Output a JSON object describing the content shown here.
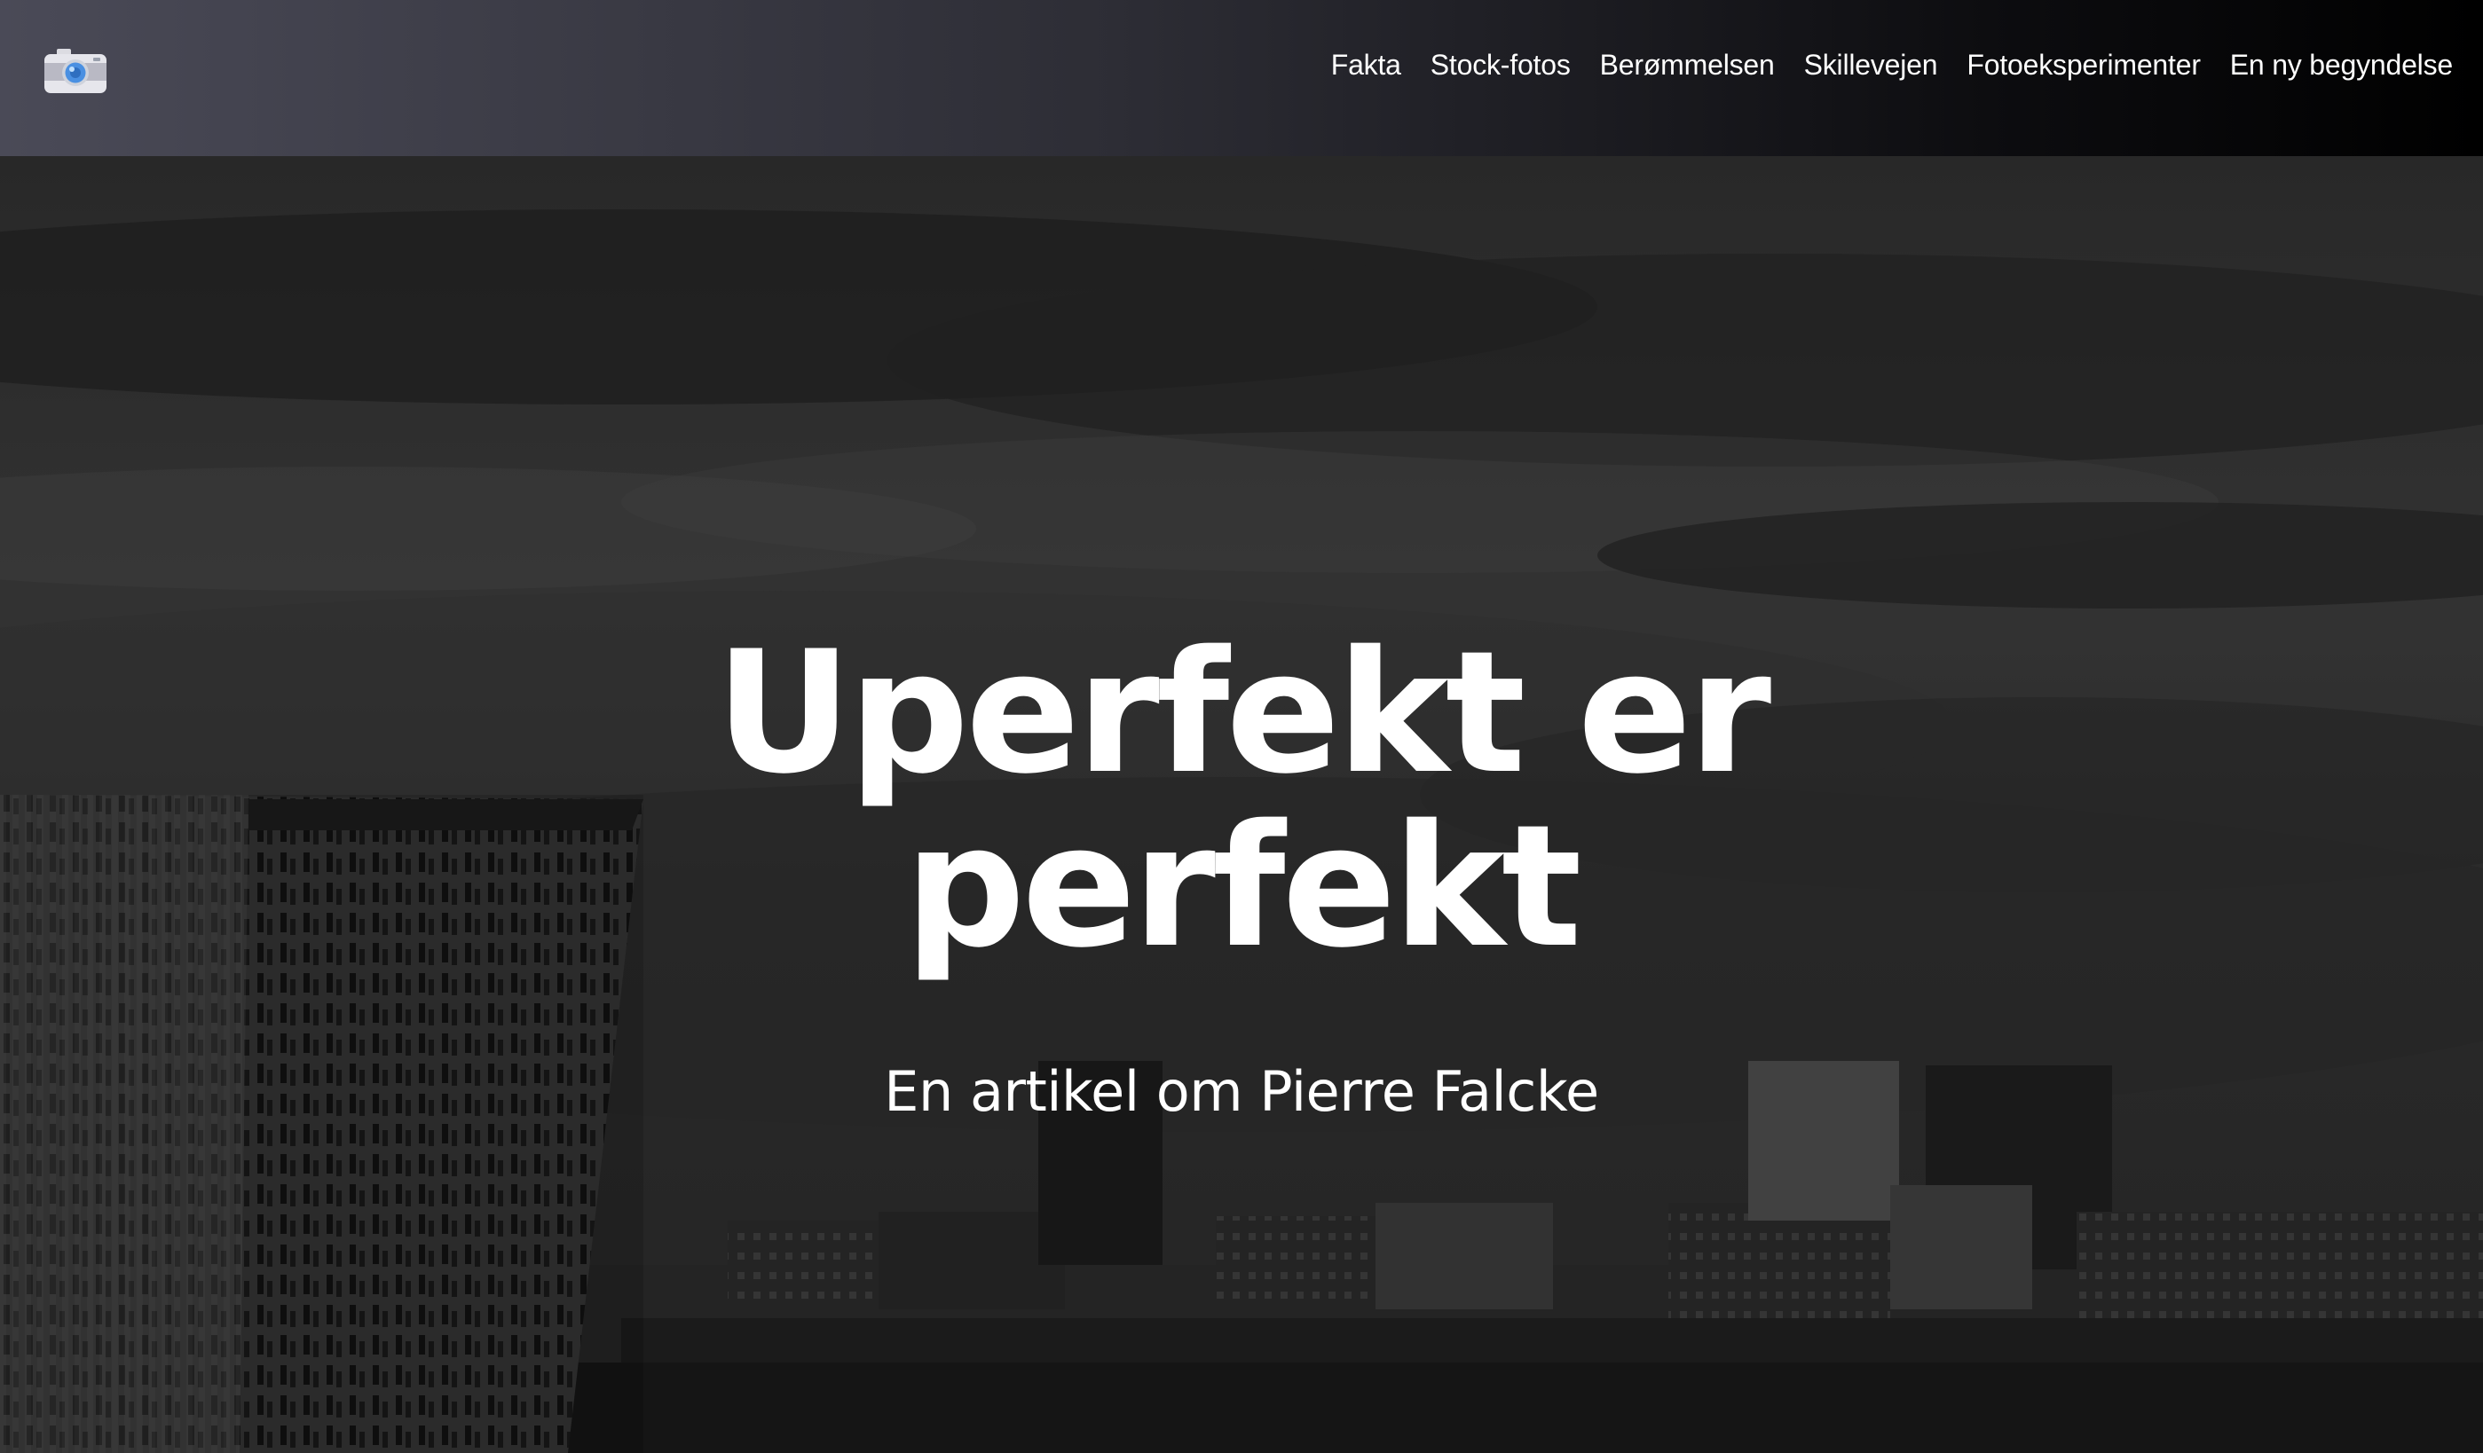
{
  "header": {
    "logo_icon": "camera-icon",
    "nav": [
      {
        "label": "Fakta"
      },
      {
        "label": "Stock-fotos"
      },
      {
        "label": "Berømmelsen"
      },
      {
        "label": "Skillevejen"
      },
      {
        "label": "Fotoeksperimenter"
      },
      {
        "label": "En ny begyndelse"
      }
    ]
  },
  "hero": {
    "title_line1": "Uperfekt er",
    "title_line2": "perfekt",
    "subtitle": "En artikel om Pierre Falcke",
    "background": "grayscale-city-skyline-photo"
  },
  "colors": {
    "nav_gradient_start": "#4a4a57",
    "nav_gradient_end": "#000000",
    "text": "#ffffff",
    "hero_overlay": "#2b2b2b",
    "logo_lens": "#4a90e2"
  }
}
